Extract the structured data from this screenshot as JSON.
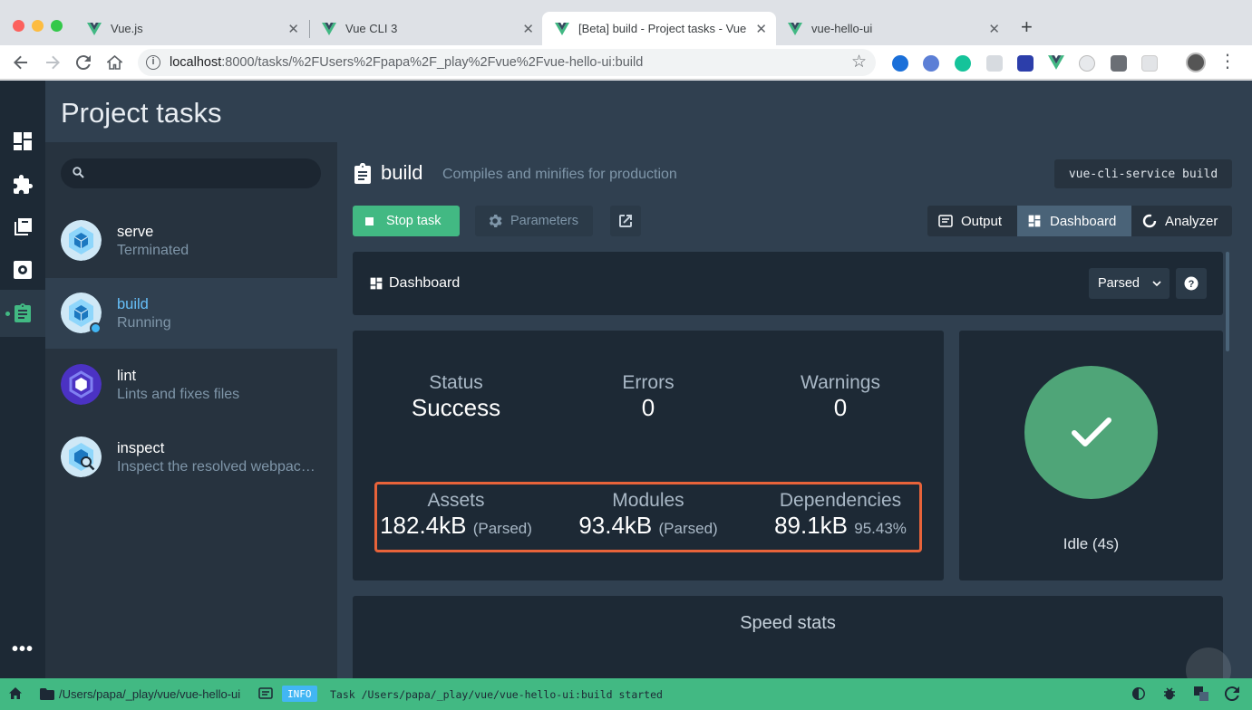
{
  "browser": {
    "tabs": [
      {
        "title": "Vue.js"
      },
      {
        "title": "Vue CLI 3"
      },
      {
        "title": "[Beta] build - Project tasks - Vue CLI"
      },
      {
        "title": "vue-hello-ui"
      }
    ],
    "url_host": "localhost",
    "url_rest": ":8000/tasks/%2FUsers%2Fpapa%2F_play%2Fvue%2Fvue-hello-ui:build"
  },
  "app": {
    "title": "Project tasks",
    "search_placeholder": "",
    "tasks": [
      {
        "name": "serve",
        "sub": "Terminated"
      },
      {
        "name": "build",
        "sub": "Running"
      },
      {
        "name": "lint",
        "sub": "Lints and fixes files"
      },
      {
        "name": "inspect",
        "sub": "Inspect the resolved webpack config"
      }
    ]
  },
  "task": {
    "name": "build",
    "description": "Compiles and minifies for production",
    "command": "vue-cli-service build",
    "stop_label": "Stop task",
    "params_label": "Parameters",
    "tabs": {
      "output": "Output",
      "dashboard": "Dashboard",
      "analyzer": "Analyzer"
    }
  },
  "dashboard": {
    "title": "Dashboard",
    "mode": "Parsed",
    "status_label": "Status",
    "status_value": "Success",
    "errors_label": "Errors",
    "errors_value": "0",
    "warnings_label": "Warnings",
    "warnings_value": "0",
    "assets_label": "Assets",
    "assets_value": "182.4kB",
    "assets_note": "(Parsed)",
    "modules_label": "Modules",
    "modules_value": "93.4kB",
    "modules_note": "(Parsed)",
    "deps_label": "Dependencies",
    "deps_value": "89.1kB",
    "deps_note": "95.43%",
    "idle_text": "Idle (4s)",
    "speed_title": "Speed stats"
  },
  "statusbar": {
    "path": "/Users/papa/_play/vue/vue-hello-ui",
    "level": "INFO",
    "log": "Task /Users/papa/_play/vue/vue-hello-ui:build started"
  },
  "colors": {
    "accent": "#42b983",
    "bg": "#304050",
    "highlight": "#e8633a"
  }
}
